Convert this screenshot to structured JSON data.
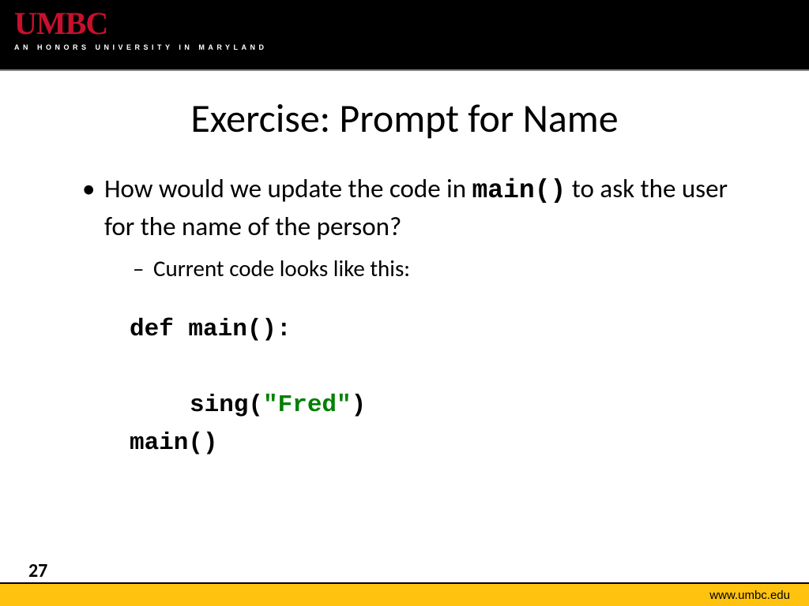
{
  "header": {
    "logo_text": "UMBC",
    "logo_tag": "AN HONORS UNIVERSITY IN MARYLAND"
  },
  "title": "Exercise: Prompt for Name",
  "bullet": {
    "before_code": "How would we update the code in ",
    "code_inline": "main()",
    "after_code": " to ask the user for the name of the person?"
  },
  "dash": "Current code looks like this:",
  "code": {
    "line1": "def main():",
    "line2_pre": "sing(",
    "line2_str": "\"Fred\"",
    "line2_post": ")",
    "line3": "main()"
  },
  "footer": {
    "page_num": "27",
    "url": "www.umbc.edu"
  }
}
